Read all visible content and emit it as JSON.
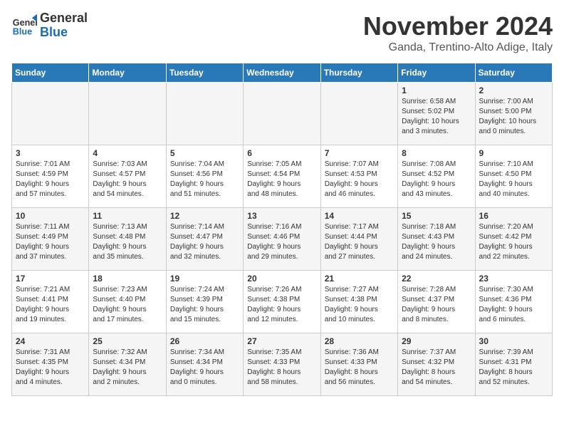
{
  "header": {
    "logo_line1": "General",
    "logo_line2": "Blue",
    "month_title": "November 2024",
    "location": "Ganda, Trentino-Alto Adige, Italy"
  },
  "days_of_week": [
    "Sunday",
    "Monday",
    "Tuesday",
    "Wednesday",
    "Thursday",
    "Friday",
    "Saturday"
  ],
  "weeks": [
    {
      "days": [
        {
          "num": "",
          "info": ""
        },
        {
          "num": "",
          "info": ""
        },
        {
          "num": "",
          "info": ""
        },
        {
          "num": "",
          "info": ""
        },
        {
          "num": "",
          "info": ""
        },
        {
          "num": "1",
          "info": "Sunrise: 6:58 AM\nSunset: 5:02 PM\nDaylight: 10 hours\nand 3 minutes."
        },
        {
          "num": "2",
          "info": "Sunrise: 7:00 AM\nSunset: 5:00 PM\nDaylight: 10 hours\nand 0 minutes."
        }
      ]
    },
    {
      "days": [
        {
          "num": "3",
          "info": "Sunrise: 7:01 AM\nSunset: 4:59 PM\nDaylight: 9 hours\nand 57 minutes."
        },
        {
          "num": "4",
          "info": "Sunrise: 7:03 AM\nSunset: 4:57 PM\nDaylight: 9 hours\nand 54 minutes."
        },
        {
          "num": "5",
          "info": "Sunrise: 7:04 AM\nSunset: 4:56 PM\nDaylight: 9 hours\nand 51 minutes."
        },
        {
          "num": "6",
          "info": "Sunrise: 7:05 AM\nSunset: 4:54 PM\nDaylight: 9 hours\nand 48 minutes."
        },
        {
          "num": "7",
          "info": "Sunrise: 7:07 AM\nSunset: 4:53 PM\nDaylight: 9 hours\nand 46 minutes."
        },
        {
          "num": "8",
          "info": "Sunrise: 7:08 AM\nSunset: 4:52 PM\nDaylight: 9 hours\nand 43 minutes."
        },
        {
          "num": "9",
          "info": "Sunrise: 7:10 AM\nSunset: 4:50 PM\nDaylight: 9 hours\nand 40 minutes."
        }
      ]
    },
    {
      "days": [
        {
          "num": "10",
          "info": "Sunrise: 7:11 AM\nSunset: 4:49 PM\nDaylight: 9 hours\nand 37 minutes."
        },
        {
          "num": "11",
          "info": "Sunrise: 7:13 AM\nSunset: 4:48 PM\nDaylight: 9 hours\nand 35 minutes."
        },
        {
          "num": "12",
          "info": "Sunrise: 7:14 AM\nSunset: 4:47 PM\nDaylight: 9 hours\nand 32 minutes."
        },
        {
          "num": "13",
          "info": "Sunrise: 7:16 AM\nSunset: 4:46 PM\nDaylight: 9 hours\nand 29 minutes."
        },
        {
          "num": "14",
          "info": "Sunrise: 7:17 AM\nSunset: 4:44 PM\nDaylight: 9 hours\nand 27 minutes."
        },
        {
          "num": "15",
          "info": "Sunrise: 7:18 AM\nSunset: 4:43 PM\nDaylight: 9 hours\nand 24 minutes."
        },
        {
          "num": "16",
          "info": "Sunrise: 7:20 AM\nSunset: 4:42 PM\nDaylight: 9 hours\nand 22 minutes."
        }
      ]
    },
    {
      "days": [
        {
          "num": "17",
          "info": "Sunrise: 7:21 AM\nSunset: 4:41 PM\nDaylight: 9 hours\nand 19 minutes."
        },
        {
          "num": "18",
          "info": "Sunrise: 7:23 AM\nSunset: 4:40 PM\nDaylight: 9 hours\nand 17 minutes."
        },
        {
          "num": "19",
          "info": "Sunrise: 7:24 AM\nSunset: 4:39 PM\nDaylight: 9 hours\nand 15 minutes."
        },
        {
          "num": "20",
          "info": "Sunrise: 7:26 AM\nSunset: 4:38 PM\nDaylight: 9 hours\nand 12 minutes."
        },
        {
          "num": "21",
          "info": "Sunrise: 7:27 AM\nSunset: 4:38 PM\nDaylight: 9 hours\nand 10 minutes."
        },
        {
          "num": "22",
          "info": "Sunrise: 7:28 AM\nSunset: 4:37 PM\nDaylight: 9 hours\nand 8 minutes."
        },
        {
          "num": "23",
          "info": "Sunrise: 7:30 AM\nSunset: 4:36 PM\nDaylight: 9 hours\nand 6 minutes."
        }
      ]
    },
    {
      "days": [
        {
          "num": "24",
          "info": "Sunrise: 7:31 AM\nSunset: 4:35 PM\nDaylight: 9 hours\nand 4 minutes."
        },
        {
          "num": "25",
          "info": "Sunrise: 7:32 AM\nSunset: 4:34 PM\nDaylight: 9 hours\nand 2 minutes."
        },
        {
          "num": "26",
          "info": "Sunrise: 7:34 AM\nSunset: 4:34 PM\nDaylight: 9 hours\nand 0 minutes."
        },
        {
          "num": "27",
          "info": "Sunrise: 7:35 AM\nSunset: 4:33 PM\nDaylight: 8 hours\nand 58 minutes."
        },
        {
          "num": "28",
          "info": "Sunrise: 7:36 AM\nSunset: 4:33 PM\nDaylight: 8 hours\nand 56 minutes."
        },
        {
          "num": "29",
          "info": "Sunrise: 7:37 AM\nSunset: 4:32 PM\nDaylight: 8 hours\nand 54 minutes."
        },
        {
          "num": "30",
          "info": "Sunrise: 7:39 AM\nSunset: 4:31 PM\nDaylight: 8 hours\nand 52 minutes."
        }
      ]
    }
  ]
}
